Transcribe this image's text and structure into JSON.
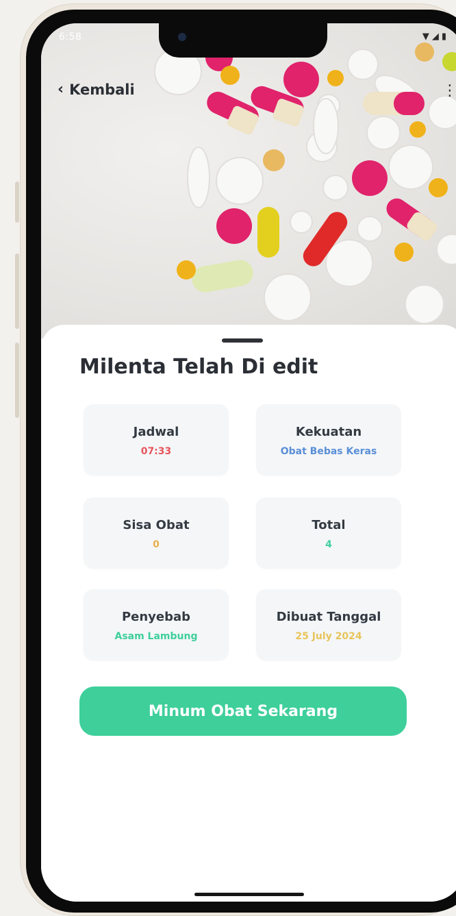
{
  "status_bar": {
    "time": "6:58"
  },
  "header": {
    "back_label": "Kembali"
  },
  "detail": {
    "title": "Milenta Telah Di edit",
    "cards": [
      {
        "label": "Jadwal",
        "value": "07:33",
        "value_color": "#e8545b"
      },
      {
        "label": "Kekuatan",
        "value": "Obat Bebas Keras",
        "value_color": "#5a8fd6"
      },
      {
        "label": "Sisa Obat",
        "value": "0",
        "value_color": "#e8b04a"
      },
      {
        "label": "Total",
        "value": "4",
        "value_color": "#3ecf9b"
      },
      {
        "label": "Penyebab",
        "value": "Asam Lambung",
        "value_color": "#3ecf9b"
      },
      {
        "label": "Dibuat Tanggal",
        "value": "25 July 2024",
        "value_color": "#e8c45a"
      }
    ]
  },
  "action": {
    "button_label": "Minum Obat Sekarang",
    "color": "#3ecf9b"
  },
  "icons": {
    "back": "chevron-left-icon",
    "menu": "menu-icon",
    "wifi": "wifi-icon",
    "signal": "signal-icon",
    "battery": "battery-icon"
  }
}
